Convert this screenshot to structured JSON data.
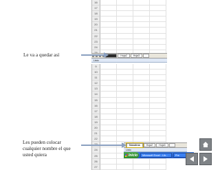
{
  "caption_top": "Le va a quedar así",
  "caption_bottom": "Les pueden colocar cualquier nombre el que usted quiera",
  "top_grid": {
    "rows": [
      "16",
      "17",
      "18",
      "19",
      "20",
      "21",
      "22",
      "23",
      "24",
      "25",
      "26"
    ]
  },
  "top_tabs": {
    "tabs": [
      "Hoja1",
      "Hoja2",
      "Hoja3"
    ],
    "status": "Listo"
  },
  "bottom_grid": {
    "rows": [
      "9",
      "10",
      "11",
      "12",
      "13",
      "14",
      "15",
      "16",
      "17",
      "18",
      "19",
      "20",
      "21",
      "22",
      "23",
      "24",
      "25",
      "26",
      "27"
    ]
  },
  "bottom_tabs": {
    "tabs": [
      "Nosotros",
      "Hoja2",
      "Hoja3"
    ],
    "status": "Listo"
  },
  "taskbar": {
    "start": "Inicio",
    "task1": "Microsoft Excel - Lib...",
    "task2": "Pre"
  },
  "colors": {
    "highlight_box": "#c8a400",
    "arrow_stroke": "#8aa0c0",
    "nav_button": "#7f8387"
  },
  "icons": [
    "home-icon",
    "back-arrow-icon",
    "next-arrow-icon",
    "windows-flag-icon"
  ]
}
